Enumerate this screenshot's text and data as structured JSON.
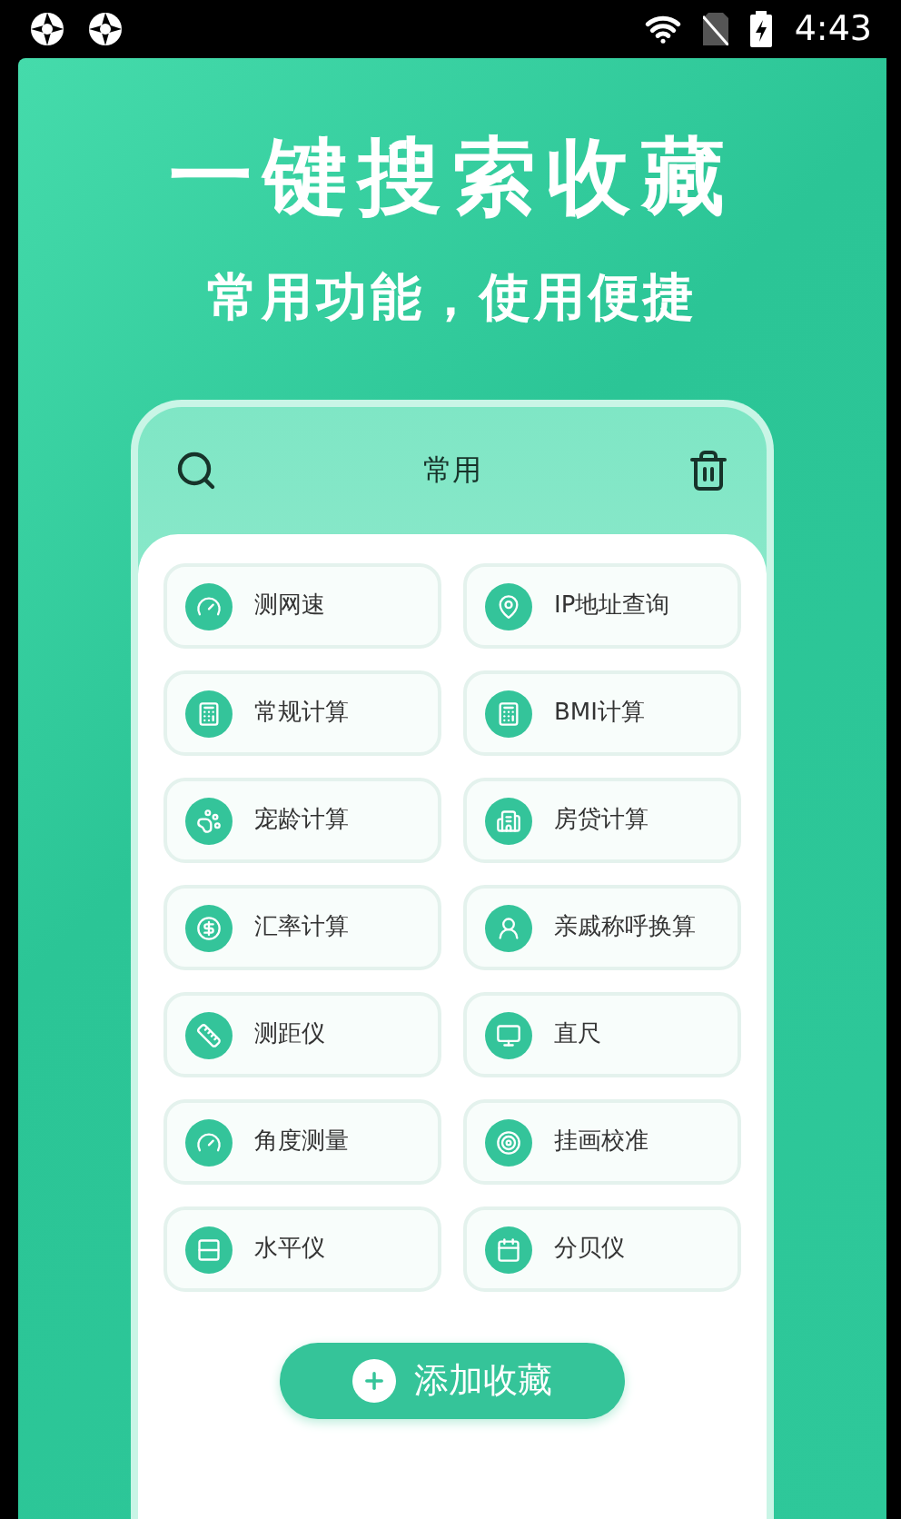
{
  "status_bar": {
    "time": "4:43"
  },
  "headline": "一键搜索收藏",
  "subheadline": "常用功能，使用便捷",
  "phone": {
    "title": "常用",
    "tools": [
      {
        "label": "测网速"
      },
      {
        "label": "IP地址查询"
      },
      {
        "label": "常规计算"
      },
      {
        "label": "BMI计算"
      },
      {
        "label": "宠龄计算"
      },
      {
        "label": "房贷计算"
      },
      {
        "label": "汇率计算"
      },
      {
        "label": "亲戚称呼换算"
      },
      {
        "label": "测距仪"
      },
      {
        "label": "直尺"
      },
      {
        "label": "角度测量"
      },
      {
        "label": "挂画校准"
      },
      {
        "label": "水平仪"
      },
      {
        "label": "分贝仪"
      }
    ],
    "add_button": "添加收藏"
  }
}
